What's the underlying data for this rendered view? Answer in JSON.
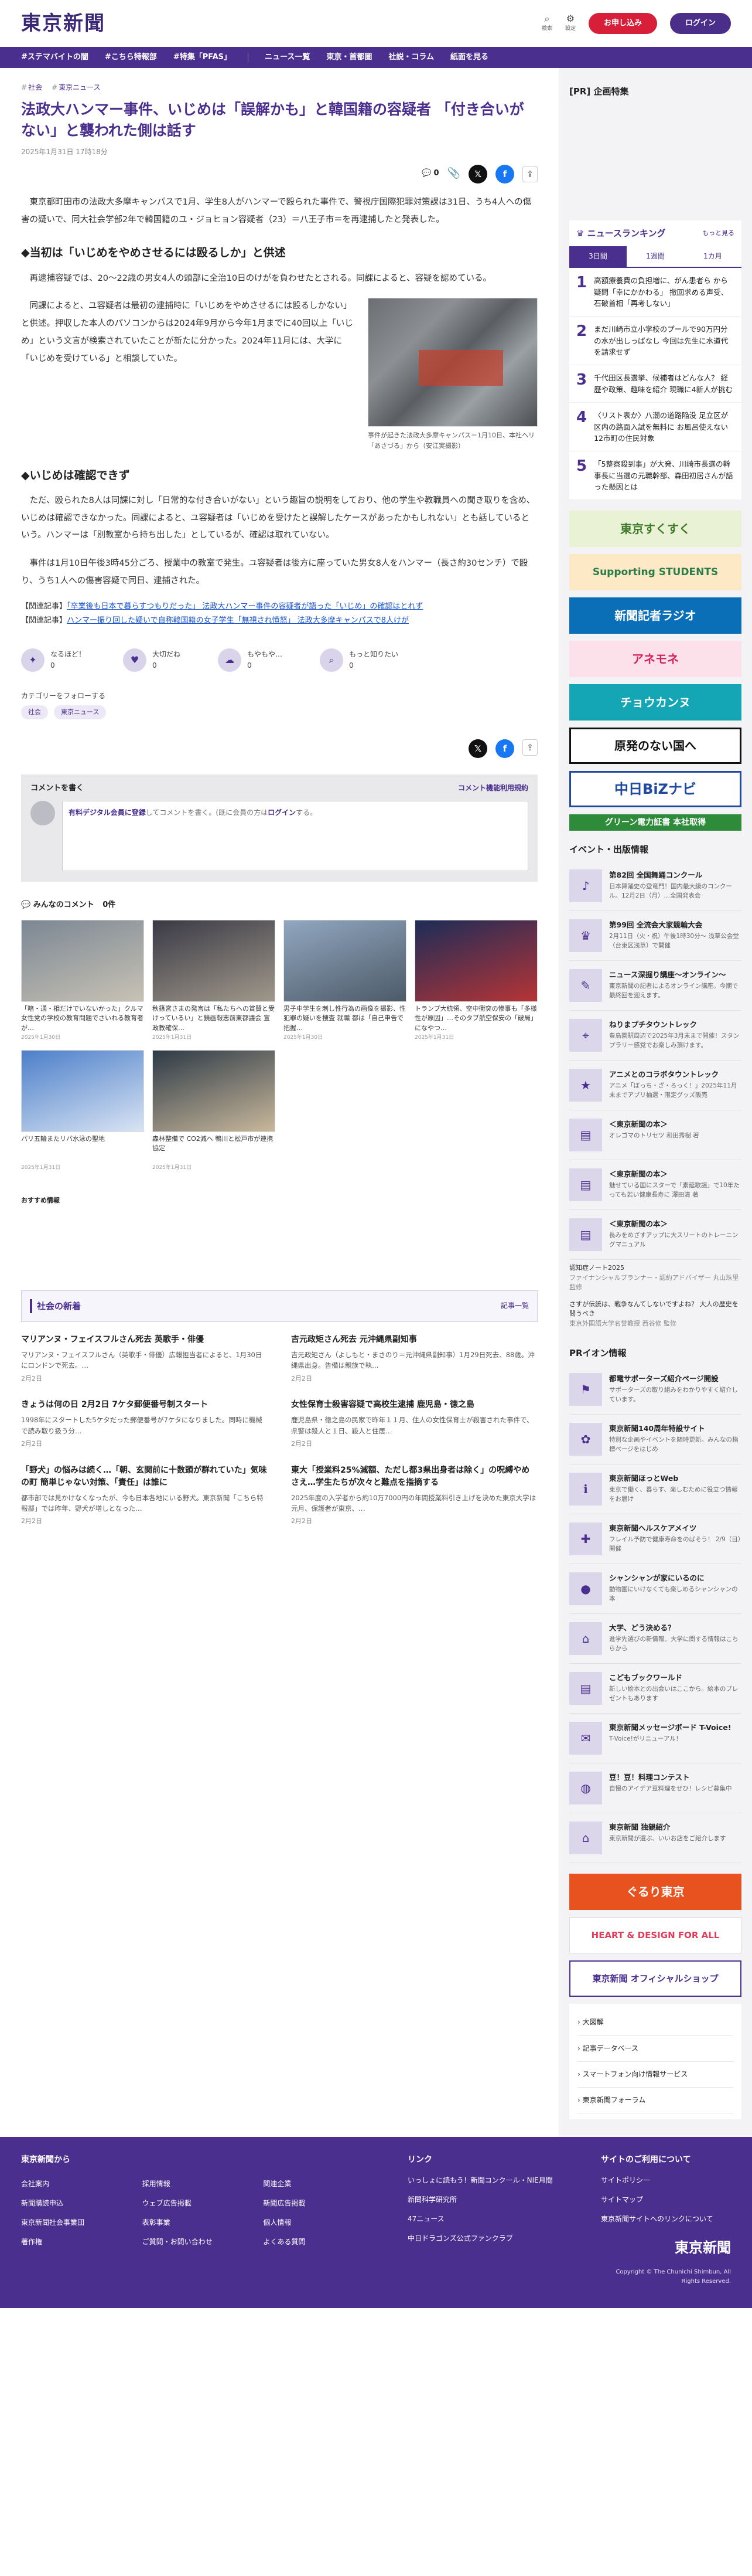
{
  "header": {
    "logo": "東京新聞",
    "search_label": "検索",
    "settings_label": "設定",
    "subscribe_label": "お申し込み",
    "login_label": "ログイン"
  },
  "nav": {
    "items": [
      "#ステマバイトの闇",
      "#こちら特報部",
      "#特集「PFAS」",
      "ニュース一覧",
      "東京・首都圏",
      "社説・コラム",
      "紙面を見る"
    ]
  },
  "article": {
    "breadcrumbs": [
      "社会",
      "東京ニュース"
    ],
    "title": "法政大ハンマー事件、いじめは「誤解かも」と韓国籍の容疑者 「付き合いがない」と襲われた側は話す",
    "date": "2025年1月31日 17時18分",
    "comment_count": "0",
    "p1": "東京都町田市の法政大多摩キャンパスで1月、学生8人がハンマーで殴られた事件で、警視庁国際犯罪対策課は31日、うち4人への傷害の疑いで、同大社会学部2年で韓国籍のユ・ジョヒョン容疑者（23）＝八王子市＝を再逮捕したと発表した。",
    "h_first": "◆当初は「いじめをやめさせるには殴るしか」と供述",
    "p2": "再逮捕容疑では、20〜22歳の男女4人の頭部に全治10日のけがを負わせたとされる。同課によると、容疑を認めている。",
    "p3": "同課によると、ユ容疑者は最初の逮捕時に「いじめをやめさせるには殴るしかない」と供述。押収した本人のパソコンからは2024年9月から今年1月までに40回以上「いじめ」という文言が検索されていたことが新たに分かった。2024年11月には、大学に「いじめを受けている」と相談していた。",
    "caption": "事件が起きた法政大多摩キャンパス＝1月10日、本社ヘリ「あさづる」から（安江実撮影）",
    "h_second": "◆いじめは確認できず",
    "p4": "ただ、殴られた8人は同課に対し「日常的な付き合いがない」という趣旨の説明をしており、他の学生や教職員への聞き取りを含め、いじめは確認できなかった。同課によると、ユ容疑者は「いじめを受けたと誤解したケースがあったかもしれない」とも話しているという。ハンマーは「別教室から持ち出した」としているが、確認は取れていない。",
    "p5": "事件は1月10日午後3時45分ごろ、授業中の教室で発生。ユ容疑者は後方に座っていた男女8人をハンマー（長さ約30センチ）で殴り、うち1人への傷害容疑で同日、逮捕された。",
    "related": [
      {
        "prefix": "【関連記事】",
        "text": "「卒業後も日本で暮らすつもりだった」 法政大ハンマー事件の容疑者が語った「いじめ」の確認はとれず"
      },
      {
        "prefix": "【関連記事】",
        "text": "ハンマー振り回した疑いで自称韓国籍の女子学生「無視され憤怒」 法政大多摩キャンパスで8人けが"
      }
    ],
    "reactions": [
      "なるほど！",
      "大切だね",
      "もやもや…",
      "もっと知りたい"
    ],
    "reaction_counts": [
      "0",
      "0",
      "0",
      "0"
    ],
    "follow_label": "カテゴリーをフォローする",
    "tags": [
      "社会",
      "東京ニュース"
    ]
  },
  "comment_box": {
    "title": "コメントを書く",
    "link": "コメント機能利用規約",
    "prompt_member": "有料デジタル会員に登録",
    "prompt_mid": "してコメントを書く。(既に会員の方は",
    "prompt_login": "ログイン",
    "prompt_end": "する。"
  },
  "everyone_comments": {
    "label": "みんなのコメント",
    "count": "0件",
    "items": [
      {
        "title": "「暗・通・相だけでいないかった」クルマ女性党の学校の教育問題でさいれる教育者が…",
        "date": "2025年1月30日"
      },
      {
        "title": "秋篠宮さまの発言は「私たちへの賞賛と受けっているい」と鏡画報志前東都議会 宣政教確保…",
        "date": "2025年1月31日"
      },
      {
        "title": "男子中学生を刺し性行為の画像を撮影、性犯罪の疑いを捜査 就職 都は「自己申告で把握…",
        "date": "2025年1月30日"
      },
      {
        "title": "トランプ大統領、空中衝突の惨事も「多様性が原因」…そのタブ航空保安の「破局」になやつ…",
        "date": "2025年1月31日"
      },
      {
        "title": "パリ五輪またリバ水泳の聖地",
        "date": "2025年1月31日"
      },
      {
        "title": "森林整備で CO2減へ 鴨川と松戸市が連携協定",
        "date": "2025年1月31日"
      }
    ]
  },
  "recommend_label": "おすすめ情報",
  "society_news": {
    "title": "社会の新着",
    "more": "記事一覧",
    "items": [
      {
        "title": "マリアンヌ・フェイスフルさん死去 英歌手・俳優",
        "summary": "マリアンヌ・フェイスフルさん（英歌手・俳優）広報担当者によると、1月30日にロンドンで死去。…",
        "date": "2月2日"
      },
      {
        "title": "吉元政矩さん死去 元沖縄県副知事",
        "summary": "吉元政矩さん（よしもと・まさのり＝元沖縄県副知事）1月29日死去、88歳。沖縄県出身。告備は親族で執…",
        "date": "2月2日"
      },
      {
        "title": "きょうは何の日 2月2日 7ケタ郵便番号制スタート",
        "summary": "1998年にスタートした5ケタだった郵便番号が7ケタになりました。同時に機械で読み取り扱う分…",
        "date": "2月2日"
      },
      {
        "title": "女性保育士殺害容疑で高校生逮捕 鹿児島・徳之島",
        "summary": "鹿児島県・徳之島の民家で昨年１１月、住人の女性保育士が殺害された事件で、県警は殺人と１日、殺人と住居…",
        "date": "2月2日"
      },
      {
        "title": "「野犬」の悩みは続く…「朝、玄関前に十数頭が群れていた」気味の町 簡単じゃない対策、「責任」は誰に",
        "summary": "都市部では見かけなくなったが、今も日本各地にいる野犬。東京新聞「こちら特報部」では昨年、野犬が増しとなった…",
        "date": "2月2日"
      },
      {
        "title": "東大「授業料25%減額、ただし都3県出身者は除く」の呪縛やめさえ…学生たちが次々と難点を指摘する",
        "summary": "2025年度の入学者から約10万7000円の年間授業料引き上げを決めた東京大学は元月、保護者が東京、…",
        "date": "2月2日"
      }
    ]
  },
  "sidebar": {
    "pr_title": "[PR] 企画特集",
    "ranking": {
      "title": "ニュースランキング",
      "more": "もっと見る",
      "tabs": [
        "3日間",
        "1週間",
        "1カ月"
      ],
      "items": [
        "高額療養費の負担増に、がん患者ら から疑問「幸にかかわる」 撤回求める声受、石破首相「再考しない」",
        "まだ川崎市立小学校のプールで90万円分の水が出しっぱなし 今回は先生に水道代を請求せず",
        "千代田区長選挙、候補者はどんな人？ 経歴や政策、趣味を紹介 現職に4新人が挑む",
        "〈リスト表か〉八潮の道路陥没 足立区が区内の路面入試を無料に お風呂使えない12市町の住民対象",
        "「5整察殺到事」が大発、川崎市長選の幹事長に当選の元職幹部、森田初居さんが語った懸因とは"
      ]
    },
    "banners": [
      "東京すくすく",
      "Supporting STUDENTS",
      "新聞記者ラジオ",
      "アネモネ",
      "チョウカンヌ",
      "原発のない国へ",
      "中日BiZナビ",
      "グリーン電力証書 本社取得"
    ],
    "events_title": "イベント・出版情報",
    "events": [
      {
        "title": "第82回 全国舞踊コンクール",
        "desc": "日本舞踊史の登竜門！国内最大級のコンクール。12月2日（月）…全国発表会"
      },
      {
        "title": "第99回 全流会大家競輪大会",
        "desc": "2月11日（火・祝）午後1時30分〜 浅草公会堂（台東区浅草）で開催"
      },
      {
        "title": "ニュース深掘り講座〜オンライン〜",
        "desc": "東京新聞の記者によるオンライン講座。今期で最終回を迎えます。"
      },
      {
        "title": "ねりまプチタウントレック",
        "desc": "豊島園駅周辺で2025年3月末まで開催！スタンプラリー感覚でお楽しみ頂けます。"
      },
      {
        "title": "アニメとのコラボタウントレック",
        "desc": "アニメ「ぼっち・ざ・ろっく！」2025年11月末までアプリ抽選・限定グッズ販売"
      },
      {
        "title": "＜東京新聞の本＞",
        "desc": "オレゴマのトリセツ 和田秀樹 著"
      },
      {
        "title": "＜東京新聞の本＞",
        "desc": "魅せている国にスターで「素延歌謡」で10年たっても若い健康長寿に 澤田清 著"
      },
      {
        "title": "＜東京新聞の本＞",
        "desc": "長みをめざすアップに大スリートのトレーニングマニュアル"
      }
    ],
    "text_ads": [
      {
        "title": "認知症ノート2025",
        "desc": "ファイナンシャルプランナー・認約アドバイザー 丸山珠里 監修"
      },
      {
        "title": "さすが伝統は、戦争なんてしないですよね？ 大人の歴史を問うべき",
        "desc": "東京外国語大学名誉教授 西谷修 監修"
      }
    ],
    "pr_events_title": "PRイオン情報",
    "pr_events": [
      {
        "title": "都電サポーターズ紹介ページ開設",
        "desc": "サポーターズの取り組みをわかりやすく紹介しています。"
      },
      {
        "title": "東京新聞140周年特設サイト",
        "desc": "特別な企画やイベントを随時更新。みんなの指標ページをはじめ"
      },
      {
        "title": "東京新聞ほっとWeb",
        "desc": "東京で働く、暮らす、楽しむために役立つ情報をお届け"
      },
      {
        "title": "東京新聞ヘルスケアメイツ",
        "desc": "フレイル予防で健康寿命をのばそう！ 2/9（日）開催"
      },
      {
        "title": "シャンシャンが家にいるのに",
        "desc": "動物園にいけなくても楽しめるシャンシャンの本"
      },
      {
        "title": "大学、どう決める？",
        "desc": "進学先選びの新情報。大学に関する情報はこちらから"
      },
      {
        "title": "こどもブックワールド",
        "desc": "新しい絵本との出会いはここから。絵本のプレゼントもあります"
      },
      {
        "title": "東京新聞メッセージボード T-Voice!",
        "desc": "T-Voice!がリニューアル！"
      },
      {
        "title": "豆！豆！料理コンテスト",
        "desc": "自慢のアイデア豆料理をぜひ！レシピ募集中"
      },
      {
        "title": "東京新聞 独親紹介",
        "desc": "東京新聞が選ぶ、いいお店をご紹介します"
      }
    ],
    "bottom_banners": [
      "ぐるり東京",
      "HEART & DESIGN FOR ALL",
      "東京新聞 オフィシャルショップ"
    ],
    "links": [
      "大図解",
      "記事データベース",
      "スマートフォン向け情報サービス",
      "東京新聞フォーラム"
    ]
  },
  "footer": {
    "col1_title": "東京新聞から",
    "col1_links": [
      "会社案内",
      "採用情報",
      "関連企業",
      "新聞購読申込",
      "ウェブ広告掲載",
      "新聞広告掲載",
      "東京新聞社会事業団",
      "表彰事業",
      "個人情報",
      "著作権",
      "ご質問・お問い合わせ",
      "よくある質問"
    ],
    "col2_title": "リンク",
    "col2_links": [
      "いっしょに読もう！新聞コンクール・NIE月間",
      "新聞科学研究所",
      "47ニュース",
      "中日ドラゴンズ公式ファンクラブ"
    ],
    "col3_title": "サイトのご利用について",
    "col3_links": [
      "サイトポリシー",
      "サイトマップ",
      "東京新聞サイトへのリンクについて"
    ],
    "logo": "東京新聞",
    "copyright": "Copyright © The Chunichi Shimbun, All Rights Reserved."
  }
}
